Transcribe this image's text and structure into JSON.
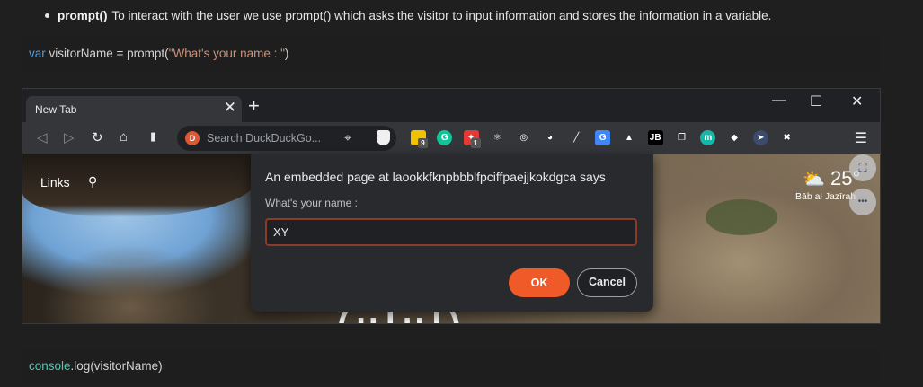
{
  "article": {
    "bullet_term": "prompt()",
    "bullet_text": "To interact with the user we use prompt() which asks the visitor to input information and stores the information in a variable.",
    "code1": {
      "keyword": "var",
      "before_string": " visitorName = prompt(",
      "string": "\"What's your name : \"",
      "after_string": ")"
    },
    "code2": {
      "object": "console",
      "rest": ".log(visitorName)"
    }
  },
  "browser": {
    "tab_title": "New Tab",
    "tab_close": "✕",
    "new_tab": "+",
    "window_controls": {
      "minimize": "—",
      "maximize": "☐",
      "close": "✕"
    },
    "toolbar": {
      "back": "◁",
      "forward": "▷",
      "reload": "↻",
      "home": "⌂",
      "bookmark": "▮",
      "search_placeholder": "Search DuckDuckGo...",
      "menu": "☰"
    },
    "extensions": [
      {
        "name": "sticky-notes-extension-icon",
        "glyph": "",
        "color": "#f2c200",
        "badge": "9"
      },
      {
        "name": "grammarly-extension-icon",
        "glyph": "G",
        "color": "#15c39a"
      },
      {
        "name": "pin-extension-icon",
        "glyph": "✦",
        "color": "#e53935",
        "badge": "1"
      },
      {
        "name": "react-devtools-extension-icon",
        "glyph": "⚛",
        "color": "#35363a"
      },
      {
        "name": "target-extension-icon",
        "glyph": "◎",
        "color": "#35363a"
      },
      {
        "name": "cookie-extension-icon",
        "glyph": "◕",
        "color": "#35363a"
      },
      {
        "name": "eyedropper-extension-icon",
        "glyph": "╱",
        "color": "#35363a"
      },
      {
        "name": "translate-extension-icon",
        "glyph": "G",
        "color": "#4285f4"
      },
      {
        "name": "google-drive-extension-icon",
        "glyph": "▲",
        "color": "#35363a"
      },
      {
        "name": "jetbrains-extension-icon",
        "glyph": "JB",
        "color": "#000000"
      },
      {
        "name": "copy-extension-icon",
        "glyph": "❐",
        "color": "#35363a"
      },
      {
        "name": "m-extension-icon",
        "glyph": "m",
        "color": "#14b8a6"
      },
      {
        "name": "diamond-extension-icon",
        "glyph": "◆",
        "color": "#35363a"
      },
      {
        "name": "cursor-extension-icon",
        "glyph": "➤",
        "color": "#3c4a6b"
      },
      {
        "name": "x-extension-icon",
        "glyph": "✖",
        "color": "#35363a"
      }
    ],
    "newtab_page": {
      "links_label": "Links",
      "search_glyph": "⚲",
      "weather_icon": "⛅",
      "temperature": "25°",
      "location": "Bāb al Jazīrah",
      "screen_btn_glyph": "⛶",
      "more_btn_glyph": "•••",
      "logo_fragment": "(ulul)"
    }
  },
  "dialog": {
    "title": "An embedded page at laookkfknpbbblfpciffpaejjkokdgca says",
    "message": "What's your name :",
    "input_value": "XY",
    "ok_label": "OK",
    "cancel_label": "Cancel"
  }
}
